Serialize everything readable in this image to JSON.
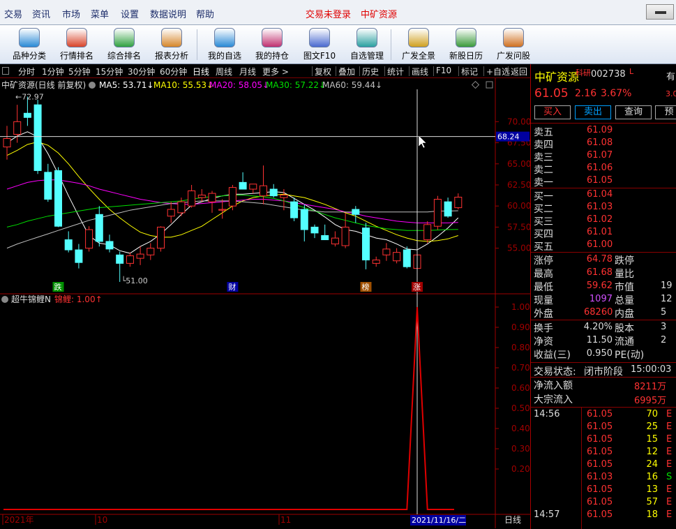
{
  "menubar": {
    "items": [
      "交易",
      "资讯",
      "市场",
      "菜单",
      "设置",
      "数据说明",
      "帮助"
    ],
    "login_status": "交易未登录",
    "stock_title": "中矿资源"
  },
  "toolbar": {
    "buttons": [
      "品种分类",
      "行情排名",
      "综合排名",
      "报表分析",
      "我的自选",
      "我的持仓",
      "图文F10",
      "自选管理",
      "广发全景",
      "新股日历",
      "广发问股"
    ]
  },
  "periodbar": {
    "periods": [
      "分时",
      "1分钟",
      "5分钟",
      "15分钟",
      "30分钟",
      "60分钟",
      "日线",
      "周线",
      "月线",
      "更多 >"
    ],
    "active_period": "日线",
    "actions": [
      "复权",
      "叠加",
      "历史",
      "统计",
      "画线",
      "F10",
      "标记",
      "+自选",
      "返回"
    ]
  },
  "colors": {
    "up": "#ff3232",
    "down": "#54ffff",
    "ma5": "#ffffff",
    "ma10": "#ffff00",
    "ma20": "#ff00ff",
    "ma30": "#00e000",
    "ma60": "#c0c0c0",
    "vol_line": "#e00000",
    "axis_red": "#a00000"
  },
  "kline_panel": {
    "legend_title": "中矿资源(日线 前复权)",
    "ma": [
      {
        "label": "MA5: 53.71↓",
        "color": "#ffffff"
      },
      {
        "label": "MA10: 55.53↓",
        "color": "#ffff00"
      },
      {
        "label": "MA20: 58.05↓",
        "color": "#ff00ff"
      },
      {
        "label": "MA30: 57.22↓",
        "color": "#00e000"
      },
      {
        "label": "MA60: 59.44↓",
        "color": "#c0c0c0"
      }
    ],
    "high_label": "72.97",
    "low_label": "51.00",
    "cursor_price": "68.24",
    "y_ticks": [
      "70.00",
      "67.50",
      "65.00",
      "62.50",
      "60.00",
      "57.50",
      "55.00"
    ],
    "markers": [
      "跌",
      "财",
      "榜",
      "涨"
    ]
  },
  "indicator_panel": {
    "title": "超牛锦鲤N",
    "value_label": "锦鲤: 1.00↑",
    "y_ticks": [
      "1.00",
      "0.90",
      "0.80",
      "0.70",
      "0.60",
      "0.50",
      "0.40",
      "0.30",
      "0.20"
    ]
  },
  "x_axis": {
    "labels": [
      "2021年",
      "10",
      "11"
    ],
    "cursor_date": "2021/11/16/二",
    "period_label": "日线"
  },
  "chart_data": {
    "type": "candlestick",
    "candles": [
      {
        "o": 67.0,
        "h": 69.5,
        "l": 65.5,
        "c": 68.0
      },
      {
        "o": 68.5,
        "h": 72.0,
        "l": 67.5,
        "c": 70.0
      },
      {
        "o": 71.0,
        "h": 72.97,
        "l": 69.5,
        "c": 70.5
      },
      {
        "o": 72.0,
        "h": 72.6,
        "l": 63.8,
        "c": 64.2
      },
      {
        "o": 64.0,
        "h": 65.0,
        "l": 60.5,
        "c": 60.8
      },
      {
        "o": 64.2,
        "h": 64.6,
        "l": 57.5,
        "c": 57.6
      },
      {
        "o": 56.0,
        "h": 57.0,
        "l": 54.5,
        "c": 54.8
      },
      {
        "o": 54.8,
        "h": 55.5,
        "l": 52.6,
        "c": 53.3
      },
      {
        "o": 55.0,
        "h": 57.6,
        "l": 54.6,
        "c": 57.2
      },
      {
        "o": 59.0,
        "h": 60.0,
        "l": 55.2,
        "c": 55.8
      },
      {
        "o": 55.8,
        "h": 56.6,
        "l": 54.5,
        "c": 54.9
      },
      {
        "o": 54.2,
        "h": 54.6,
        "l": 51.0,
        "c": 53.2
      },
      {
        "o": 53.2,
        "h": 54.5,
        "l": 52.8,
        "c": 54.1
      },
      {
        "o": 53.8,
        "h": 55.2,
        "l": 53.0,
        "c": 54.3
      },
      {
        "o": 54.2,
        "h": 55.6,
        "l": 53.6,
        "c": 55.0
      },
      {
        "o": 55.0,
        "h": 57.6,
        "l": 54.6,
        "c": 57.5
      },
      {
        "o": 58.8,
        "h": 60.5,
        "l": 58.0,
        "c": 59.6
      },
      {
        "o": 59.2,
        "h": 61.0,
        "l": 58.8,
        "c": 60.5
      },
      {
        "o": 60.0,
        "h": 62.5,
        "l": 59.8,
        "c": 61.8
      },
      {
        "o": 61.0,
        "h": 62.0,
        "l": 60.5,
        "c": 61.3
      },
      {
        "o": 60.5,
        "h": 61.8,
        "l": 59.2,
        "c": 61.5
      },
      {
        "o": 59.5,
        "h": 60.8,
        "l": 58.5,
        "c": 59.6
      },
      {
        "o": 60.0,
        "h": 62.5,
        "l": 59.5,
        "c": 62.2
      },
      {
        "o": 62.8,
        "h": 64.0,
        "l": 62.0,
        "c": 62.0
      },
      {
        "o": 62.0,
        "h": 62.6,
        "l": 61.5,
        "c": 62.6
      },
      {
        "o": 61.2,
        "h": 64.8,
        "l": 60.2,
        "c": 62.4
      },
      {
        "o": 62.0,
        "h": 62.6,
        "l": 61.0,
        "c": 61.2
      },
      {
        "o": 61.0,
        "h": 62.0,
        "l": 59.5,
        "c": 61.3
      },
      {
        "o": 60.5,
        "h": 61.0,
        "l": 58.2,
        "c": 58.6
      },
      {
        "o": 59.6,
        "h": 60.2,
        "l": 55.8,
        "c": 57.2
      },
      {
        "o": 57.5,
        "h": 57.8,
        "l": 56.2,
        "c": 56.8
      },
      {
        "o": 56.5,
        "h": 57.8,
        "l": 56.0,
        "c": 56.0
      },
      {
        "o": 55.5,
        "h": 57.0,
        "l": 55.2,
        "c": 56.2
      },
      {
        "o": 55.3,
        "h": 59.2,
        "l": 55.0,
        "c": 57.5
      },
      {
        "o": 59.6,
        "h": 60.0,
        "l": 58.0,
        "c": 59.0
      },
      {
        "o": 57.4,
        "h": 58.0,
        "l": 52.5,
        "c": 53.6
      },
      {
        "o": 53.2,
        "h": 54.0,
        "l": 52.8,
        "c": 53.6
      },
      {
        "o": 54.2,
        "h": 55.6,
        "l": 53.5,
        "c": 54.9
      },
      {
        "o": 53.5,
        "h": 55.0,
        "l": 53.2,
        "c": 54.5
      },
      {
        "o": 54.8,
        "h": 55.2,
        "l": 52.6,
        "c": 52.8
      },
      {
        "o": 52.6,
        "h": 55.0,
        "l": 52.0,
        "c": 54.2
      },
      {
        "o": 56.0,
        "h": 58.2,
        "l": 55.6,
        "c": 57.8
      },
      {
        "o": 57.6,
        "h": 61.2,
        "l": 57.2,
        "c": 60.8
      },
      {
        "o": 60.5,
        "h": 61.0,
        "l": 58.6,
        "c": 58.8
      },
      {
        "o": 59.8,
        "h": 61.5,
        "l": 59.6,
        "c": 61.05
      }
    ],
    "ma_series": [
      {
        "label": "MA5",
        "values": [
          67.5,
          68.3,
          68.8,
          68.2,
          66.2,
          63.8,
          61.2,
          58.8,
          56.5,
          55.6,
          55.4,
          54.7,
          54.4,
          55.2,
          55.8,
          56.7,
          57.8,
          59.0,
          60.1,
          60.5,
          60.9,
          61.2,
          61.4,
          61.4,
          61.5,
          61.6,
          61.7,
          61.6,
          60.9,
          60.2,
          59.5,
          58.7,
          57.8,
          57.2,
          57.0,
          56.6,
          56.2,
          56.0,
          55.5,
          54.9,
          54.8,
          55.5,
          56.4,
          57.4,
          58.6
        ]
      },
      {
        "label": "MA10",
        "values": [
          66.0,
          66.6,
          67.3,
          67.6,
          67.2,
          66.3,
          65.0,
          63.5,
          62.1,
          60.8,
          59.6,
          58.6,
          57.7,
          56.9,
          56.5,
          56.3,
          56.3,
          56.6,
          57.1,
          57.6,
          58.4,
          59.2,
          60.0,
          60.6,
          61.0,
          61.2,
          61.3,
          61.4,
          61.2,
          61.0,
          60.6,
          60.2,
          59.7,
          59.2,
          58.8,
          58.2,
          57.6,
          57.1,
          56.6,
          56.2,
          55.9,
          55.8,
          55.9,
          56.1,
          56.5
        ]
      },
      {
        "label": "MA20",
        "values": [
          62.0,
          62.4,
          62.8,
          63.0,
          63.1,
          63.1,
          62.9,
          62.7,
          62.4,
          62.0,
          61.7,
          61.4,
          61.1,
          60.8,
          60.6,
          60.4,
          60.3,
          60.2,
          60.2,
          60.3,
          60.4,
          60.5,
          60.6,
          60.7,
          60.8,
          60.8,
          60.7,
          60.6,
          60.4,
          60.2,
          60.0,
          59.8,
          59.6,
          59.3,
          59.1,
          58.8,
          58.6,
          58.4,
          58.2,
          58.1,
          58.0,
          58.0,
          58.0,
          58.0,
          58.05
        ]
      },
      {
        "label": "MA30",
        "values": [
          57.5,
          57.8,
          58.2,
          58.5,
          58.8,
          59.0,
          59.2,
          59.4,
          59.6,
          59.8,
          59.9,
          60.0,
          60.1,
          60.2,
          60.3,
          60.4,
          60.5,
          60.6,
          60.8,
          61.0,
          61.1,
          61.2,
          61.3,
          61.3,
          61.2,
          61.1,
          60.9,
          60.6,
          60.2,
          59.8,
          59.4,
          59.0,
          58.6,
          58.3,
          58.0,
          57.7,
          57.5,
          57.3,
          57.2,
          57.1,
          57.1,
          57.1,
          57.15,
          57.2,
          57.22
        ]
      },
      {
        "label": "MA60",
        "values": [
          55.0,
          55.5,
          55.9,
          56.3,
          56.7,
          57.1,
          57.5,
          57.9,
          58.3,
          58.6,
          58.9,
          59.2,
          59.5,
          59.7,
          59.9,
          60.1,
          60.3,
          60.4,
          60.5,
          60.6,
          60.6,
          60.6,
          60.6,
          60.5,
          60.4,
          60.3,
          60.1,
          59.9,
          59.7,
          59.5,
          59.4,
          59.3,
          59.3,
          59.3,
          59.3,
          59.3,
          59.3,
          59.3,
          59.3,
          59.3,
          59.3,
          59.3,
          59.4,
          59.4,
          59.44
        ]
      }
    ],
    "indicator_series": {
      "label": "锦鲤",
      "values": [
        0,
        0,
        0,
        0,
        0,
        0,
        0,
        0,
        0,
        0,
        0,
        0,
        0,
        0,
        0,
        0,
        0,
        0,
        0,
        0,
        0,
        0,
        0,
        0,
        0,
        0,
        0,
        0,
        0,
        0,
        0,
        0,
        0,
        0,
        0,
        0,
        0,
        0,
        0,
        0,
        1,
        0,
        0,
        0,
        0
      ]
    },
    "ylim": [
      50.5,
      74.0
    ]
  },
  "quote": {
    "name": "中矿资源",
    "board": "科研",
    "code": "002738",
    "code_suffix": "L",
    "cut_right": "有",
    "price": "61.05",
    "change": "2.16",
    "change_pct": "3.67%",
    "cut_val": "3.0",
    "buttons": [
      "买入",
      "卖出",
      "查询",
      "预"
    ],
    "sell": [
      {
        "label": "卖五",
        "price": "61.09"
      },
      {
        "label": "卖四",
        "price": "61.08"
      },
      {
        "label": "卖三",
        "price": "61.07"
      },
      {
        "label": "卖二",
        "price": "61.06"
      },
      {
        "label": "卖一",
        "price": "61.05"
      }
    ],
    "buy": [
      {
        "label": "买一",
        "price": "61.04"
      },
      {
        "label": "买二",
        "price": "61.03"
      },
      {
        "label": "买三",
        "price": "61.02"
      },
      {
        "label": "买四",
        "price": "61.01"
      },
      {
        "label": "买五",
        "price": "61.00"
      }
    ],
    "stats": [
      {
        "l": "涨停",
        "v": "64.78",
        "vc": "#ff3232",
        "l2": "跌停",
        "v2": ""
      },
      {
        "l": "最高",
        "v": "61.68",
        "vc": "#ff3232",
        "l2": "量比",
        "v2": ""
      },
      {
        "l": "最低",
        "v": "59.62",
        "vc": "#ff3232",
        "l2": "市值",
        "v2": "19"
      },
      {
        "l": "现量",
        "v": "1097",
        "vc": "#d050ff",
        "l2": "总量",
        "v2": "12"
      },
      {
        "l": "外盘",
        "v": "68260",
        "vc": "#ff3232",
        "l2": "内盘",
        "v2": "5"
      }
    ],
    "stats2": [
      {
        "l": "换手",
        "v": "4.20%",
        "l2": "股本",
        "v2": "3"
      },
      {
        "l": "净资",
        "v": "11.50",
        "l2": "流通",
        "v2": "2"
      },
      {
        "l": "收益(三)",
        "v": "0.950",
        "l2": "PE(动)",
        "v2": ""
      }
    ],
    "trade_status_label": "交易状态:",
    "trade_status": "闭市阶段",
    "trade_time": "15:00:03",
    "net_inflow_label": "净流入额",
    "net_inflow": "8211万",
    "block_inflow_label": "大宗流入",
    "block_inflow": "6995万",
    "ticks": [
      {
        "t": "14:56",
        "p": "61.05",
        "v": "70",
        "s": "E"
      },
      {
        "t": "",
        "p": "61.05",
        "v": "25",
        "s": "E"
      },
      {
        "t": "",
        "p": "61.05",
        "v": "15",
        "s": "E"
      },
      {
        "t": "",
        "p": "61.05",
        "v": "12",
        "s": "E"
      },
      {
        "t": "",
        "p": "61.05",
        "v": "24",
        "s": "E"
      },
      {
        "t": "",
        "p": "61.03",
        "v": "16",
        "s": "S"
      },
      {
        "t": "",
        "p": "61.05",
        "v": "13",
        "s": "E"
      },
      {
        "t": "",
        "p": "61.05",
        "v": "57",
        "s": "E"
      },
      {
        "t": "14:57",
        "p": "61.05",
        "v": "18",
        "s": "E"
      }
    ]
  }
}
